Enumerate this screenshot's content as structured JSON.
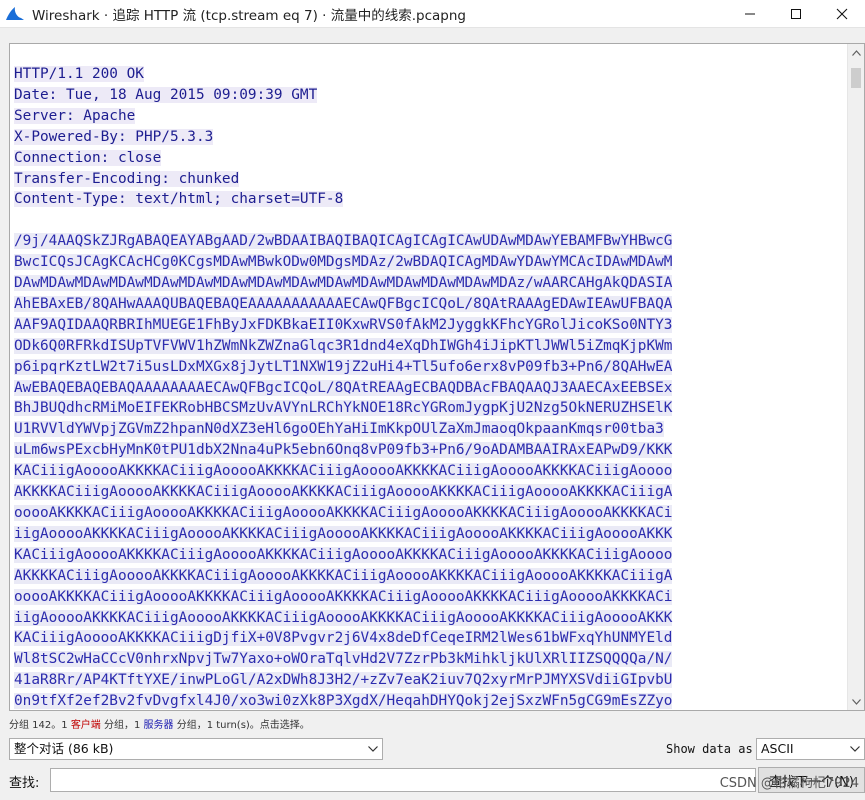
{
  "window": {
    "title": "Wireshark · 追踪 HTTP 流 (tcp.stream eq 7) · 流量中的线索.pcapng",
    "minimize_label": "minimize",
    "maximize_label": "maximize",
    "close_label": "close"
  },
  "stream": {
    "headers": [
      "HTTP/1.1 200 OK",
      "Date: Tue, 18 Aug 2015 09:09:39 GMT",
      "Server: Apache",
      "X-Powered-By: PHP/5.3.3",
      "Connection: close",
      "Transfer-Encoding: chunked",
      "Content-Type: text/html; charset=UTF-8"
    ],
    "body": [
      "/9j/4AAQSkZJRgABAQEAYABgAAD/2wBDAAIBAQIBAQICAgICAgICAwUDAwMDAwYEBAMFBwYHBwcG",
      "BwcICQsJCAgKCAcHCg0KCgsMDAwMBwkODw0MDgsMDAz/2wBDAQICAgMDAwYDAwYMCAcIDAwMDAwM",
      "DAwMDAwMDAwMDAwMDAwMDAwMDAwMDAwMDAwMDAwMDAwMDAwMDAwMDAwMDAz/wAARCAHgAkQDASIA",
      "AhEBAxEB/8QAHwAAAQUBAQEBAQEAAAAAAAAAAAECAwQFBgcICQoL/8QAtRAAAgEDAwIEAwUFBAQA",
      "AAF9AQIDAAQRBRIhMUEGE1FhByJxFDKBkaEII0KxwRVS0fAkM2JyggkKFhcYGRolJicoKSo0NTY3",
      "ODk6Q0RFRkdISUpTVFVWV1hZWmNkZWZnaGlqc3R1dnd4eXqDhIWGh4iJipKTlJWWl5iZmqKjpKWm",
      "p6ipqrKztLW2t7i5usLDxMXGx8jJytLT1NXW19jZ2uHi4+Tl5ufo6erx8vP09fb3+Pn6/8QAHwEA",
      "AwEBAQEBAQEBAQAAAAAAAAECAwQFBgcICQoL/8QAtREAAgECBAQDBAcFBAQAAQJ3AAECAxEEBSEx",
      "BhJBUQdhcRMiMoEIFEKRobHBCSMzUvAVYnLRChYkNOE18RcYGRomJygpKjU2Nzg5OkNERUZHSElK",
      "U1RVVldYWVpjZGVmZ2hpanN0dXZ3eHl6goOEhYaHiImKkpOUlZaXmJmaoqOkpaanKmqsr00tba3",
      "uLm6wsPExcbHyMnK0tPU1dbX2Nna4uPk5ebn6Onq8vP09fb3+Pn6/9oADAMBAAIRAxEAPwD9/KKK",
      "KACiiigAooooAKKKKACiiigAooooAKKKKACiiigAooooAKKKKACiiigAooooAKKKKACiiigAoooo",
      "AKKKKACiiigAooooAKKKKACiiigAooooAKKKKACiiigAooooAKKKKACiiigAooooAKKKKACiiigA",
      "ooooAKKKKACiiigAooooAKKKKACiiigAooooAKKKKACiiigAooooAKKKKACiiigAooooAKKKKACi",
      "iigAooooAKKKKACiiigAooooAKKKKACiiigAooooAKKKKACiiigAooooAKKKKACiiigAooooAKKK",
      "KACiiigAooooAKKKKACiiigAooooAKKKKACiiigAooooAKKKKACiiigAooooAKKKKACiiigAoooo",
      "AKKKKACiiigAooooAKKKKACiiigAooooAKKKKACiiigAooooAKKKKACiiigAooooAKKKKACiiigA",
      "ooooAKKKKACiiigAooooAKKKKACiiigAooooAKKKKACiiigAooooAKKKKACiiigAooooAKKKKACi",
      "iigAooooAKKKKACiiigAooooAKKKKACiiigAooooAKKKKACiiigAooooAKKKKACiiigAooooAKKK",
      "KACiiigAooooAKKKKACiiigDjfiX+0V8Pvgvr2j6V4x8deDfCeqeIRM2lWes61bWFxqYhUNMYEld",
      "Wl8tSC2wHaCCcV0nhrxNpvjTw7Yaxo+oWOraTqlvHd2V7ZzrPb3kMihkljkUlXRlIIZSQQQQa/N/",
      "41aR8Rr/AP4KTftYXE/inwPLoGl/A2xDWh8J3H2/+zZv7eaK2iuv7Q2xyrMrPJMYXSVdiiGIpvbU",
      "0n9tfXf2ef2Bv2fvDvgfxl4J0/xo3wi0zXk8P3XgdX/HeqahDHYQokj2ejSxzWFn5gCG9mEsZZyo"
    ]
  },
  "status": {
    "prefix": "分组 142。1 ",
    "client": "客户端",
    "middle": " 分组，1 ",
    "server": "服务器",
    "suffix": " 分组，1 turn(s)。点击选择。"
  },
  "controls": {
    "conversation_value": "整个对话 (86 kB)",
    "show_data_label": "Show data as",
    "show_data_value": "ASCII",
    "find_label": "查找:",
    "find_value": "",
    "find_next_button": "查找下一个(N)",
    "watermark": "CSDN @柑橘枸杞7924"
  },
  "colors": {
    "server_text": "#1d1d90",
    "server_bg": "#edeaf7",
    "client_red": "#c00000"
  },
  "icons": {
    "app": "wireshark-fin-icon",
    "minimize": "minimize-icon",
    "maximize": "maximize-icon",
    "close": "close-icon",
    "dropdown": "chevron-down-icon"
  }
}
